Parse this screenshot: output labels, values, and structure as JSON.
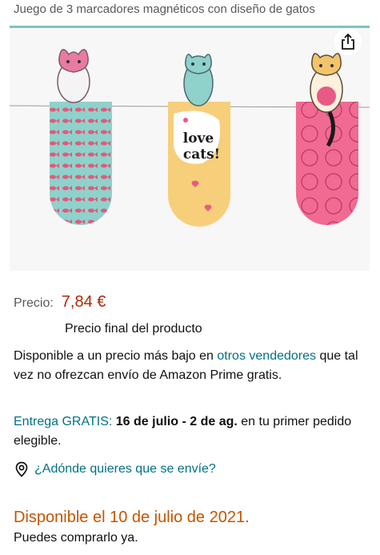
{
  "product": {
    "title": "Juego de 3 marcadores magnéticos con diseño de gatos",
    "image_text": {
      "line1": "love",
      "line2": "cats!"
    },
    "share_icon": "share-icon"
  },
  "price": {
    "label": "Precio:",
    "value": "7,84 €",
    "final_note": "Precio final del producto"
  },
  "availability": {
    "text_before": "Disponible a un precio más bajo en ",
    "link_text": "otros vendedores",
    "text_after": " que tal vez no ofrezcan envío de Amazon Prime gratis."
  },
  "delivery": {
    "free_label": "Entrega GRATIS:",
    "dates": "16 de julio - 2 de ag.",
    "suffix": "en tu primer pedido elegible."
  },
  "location": {
    "icon": "location-pin-icon",
    "text": "¿Adónde quieres que se envíe?"
  },
  "stock": {
    "status": "Disponible el 10 de julio de 2021.",
    "note": "Puedes comprarlo ya."
  },
  "colors": {
    "price": "#b12704",
    "link": "#007185",
    "stock": "#c45500",
    "text": "#0f1111",
    "muted": "#565959"
  }
}
